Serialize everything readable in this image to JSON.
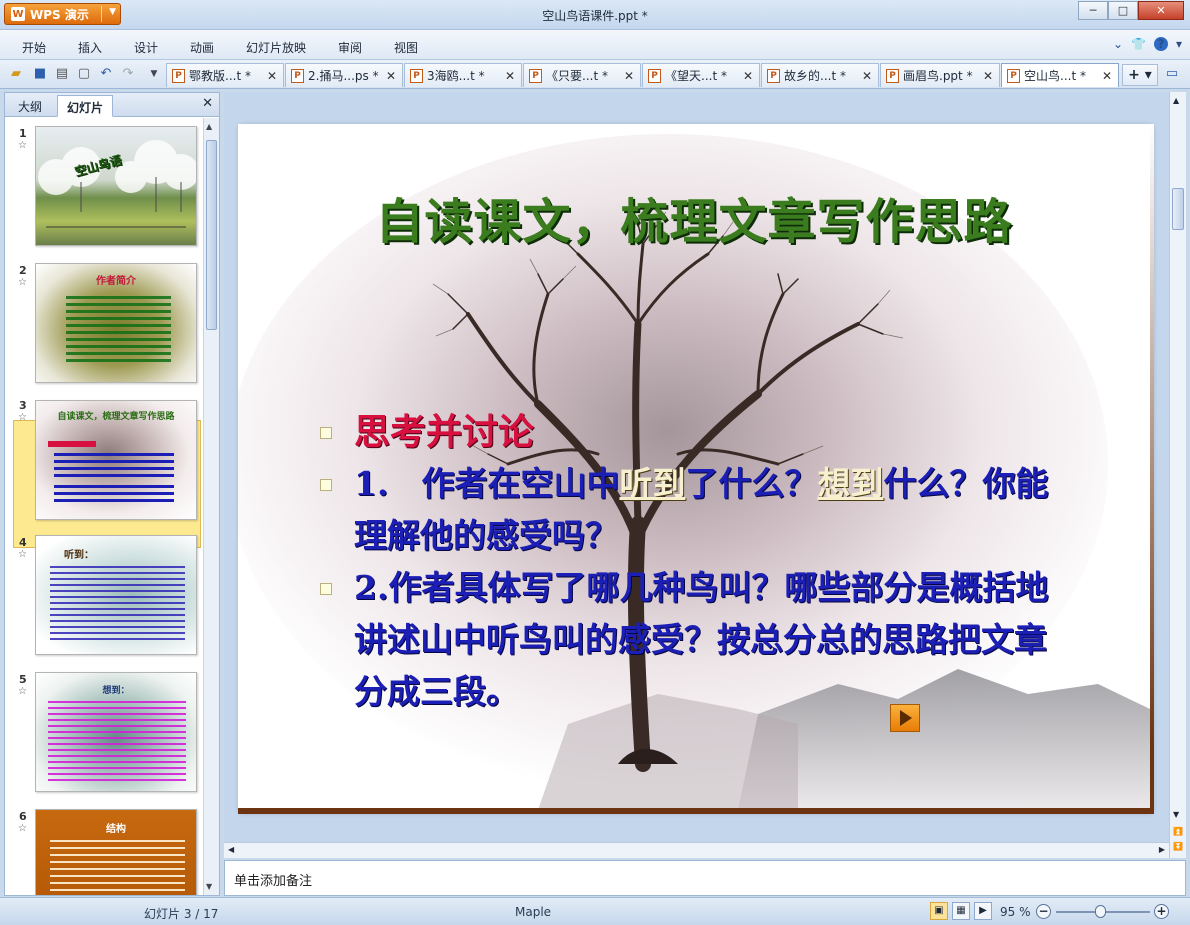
{
  "window": {
    "app_label": "WPS 演示",
    "title": "空山鸟语课件.ppt *"
  },
  "menu": {
    "items": [
      "开始",
      "插入",
      "设计",
      "动画",
      "幻灯片放映",
      "审阅",
      "视图"
    ]
  },
  "tabs": [
    {
      "label": "鄂教版...t *"
    },
    {
      "label": "2.捅马...ps *"
    },
    {
      "label": "3海鸥...t *"
    },
    {
      "label": "《只要...t *"
    },
    {
      "label": "《望天...t *"
    },
    {
      "label": "故乡的...t *"
    },
    {
      "label": "画眉鸟.ppt *"
    },
    {
      "label": "空山鸟...t *"
    }
  ],
  "left_panel": {
    "tab_outline": "大纲",
    "tab_slides": "幻灯片",
    "thumbnails": [
      {
        "num": "1",
        "star": "☆",
        "title": "空山鸟语"
      },
      {
        "num": "2",
        "star": "☆",
        "title": "作者简介"
      },
      {
        "num": "3",
        "star": "☆",
        "title": "自读课文，梳理文章写作思路"
      },
      {
        "num": "4",
        "star": "☆",
        "title": "听到："
      },
      {
        "num": "5",
        "star": "☆",
        "title": "想到："
      },
      {
        "num": "6",
        "star": "☆",
        "title": "结构"
      }
    ]
  },
  "slide": {
    "title": "自读课文，梳理文章写作思路",
    "heading": "思考并讨论",
    "q1_a": "1.　作者在空山中",
    "q1_u1": "听到",
    "q1_b": "了什么？",
    "q1_u2": "想到",
    "q1_c": "什么？你能理解他的感受吗？",
    "q2": "2.作者具体写了哪几种鸟叫？哪些部分是概括地讲述山中听鸟叫的感受？按总分总的思路把文章分成三段。"
  },
  "notes": {
    "placeholder": "单击添加备注"
  },
  "status": {
    "slide_counter": "幻灯片 3 / 17",
    "theme": "Maple",
    "zoom": "95 %"
  }
}
